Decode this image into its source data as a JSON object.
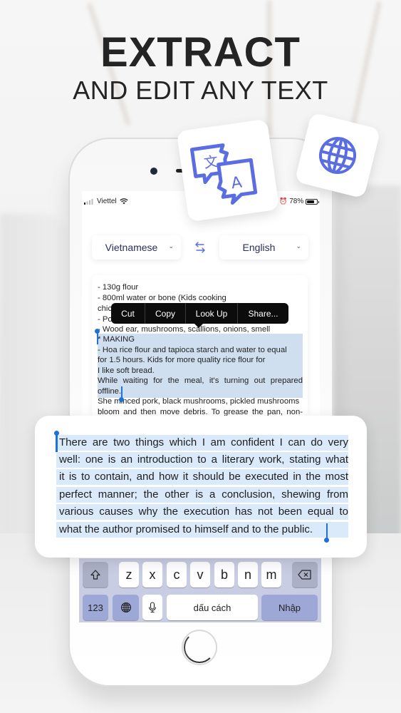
{
  "headline": {
    "title": "EXTRACT",
    "subtitle": "AND EDIT ANY TEXT"
  },
  "floating_icons": [
    {
      "name": "translate-icon",
      "glyph_left": "文",
      "glyph_right": "A"
    },
    {
      "name": "globe-icon"
    }
  ],
  "status_bar": {
    "carrier": "Viettel",
    "battery": "78%",
    "battery_level": 0.78
  },
  "language_bar": {
    "source": "Vietnamese",
    "target": "English",
    "swap_icon": "swap-arrows-icon"
  },
  "source_text": {
    "lines": [
      "- 130g flour",
      "- 800ml water or bone (Kids cooking",
      "chic",
      "- Po",
      "- Wood ear, mushrooms, scallions, onions, smell",
      "* MAKING",
      "- Hoa rice flour and tapioca starch and water to equal",
      "for 1.5 hours. Kids for more quality rice flour for",
      "I like soft bread.",
      "While waiting for the meal, it's turning out prepared",
      "offline.",
      "She minced pork, black mushrooms, pickled mushrooms",
      "bloom and then move debris. To grease the pan, non-"
    ]
  },
  "context_menu": {
    "items": [
      "Cut",
      "Copy",
      "Look Up",
      "Share..."
    ]
  },
  "translated_text": {
    "lines": [
      "There are two things which I am confident I can do very",
      "well: one is an introduction to a literary work, stating what",
      "it is to contain, and how it should be executed in the most",
      "perfect manner; the other is a conclusion, shewing from",
      "various causes why the execution has not been equal to",
      "what the author promised to himself and to the public."
    ]
  },
  "keyboard": {
    "row3": [
      "z",
      "x",
      "c",
      "v",
      "b",
      "n",
      "m"
    ],
    "numbers_key": "123",
    "space_key": "dấu cách",
    "return_key": "Nhập"
  },
  "colors": {
    "accent": "#5b6ee1",
    "selection": "#cfdff0",
    "handle": "#1e72d6",
    "keyboard_dark": "#9ea8d6"
  }
}
